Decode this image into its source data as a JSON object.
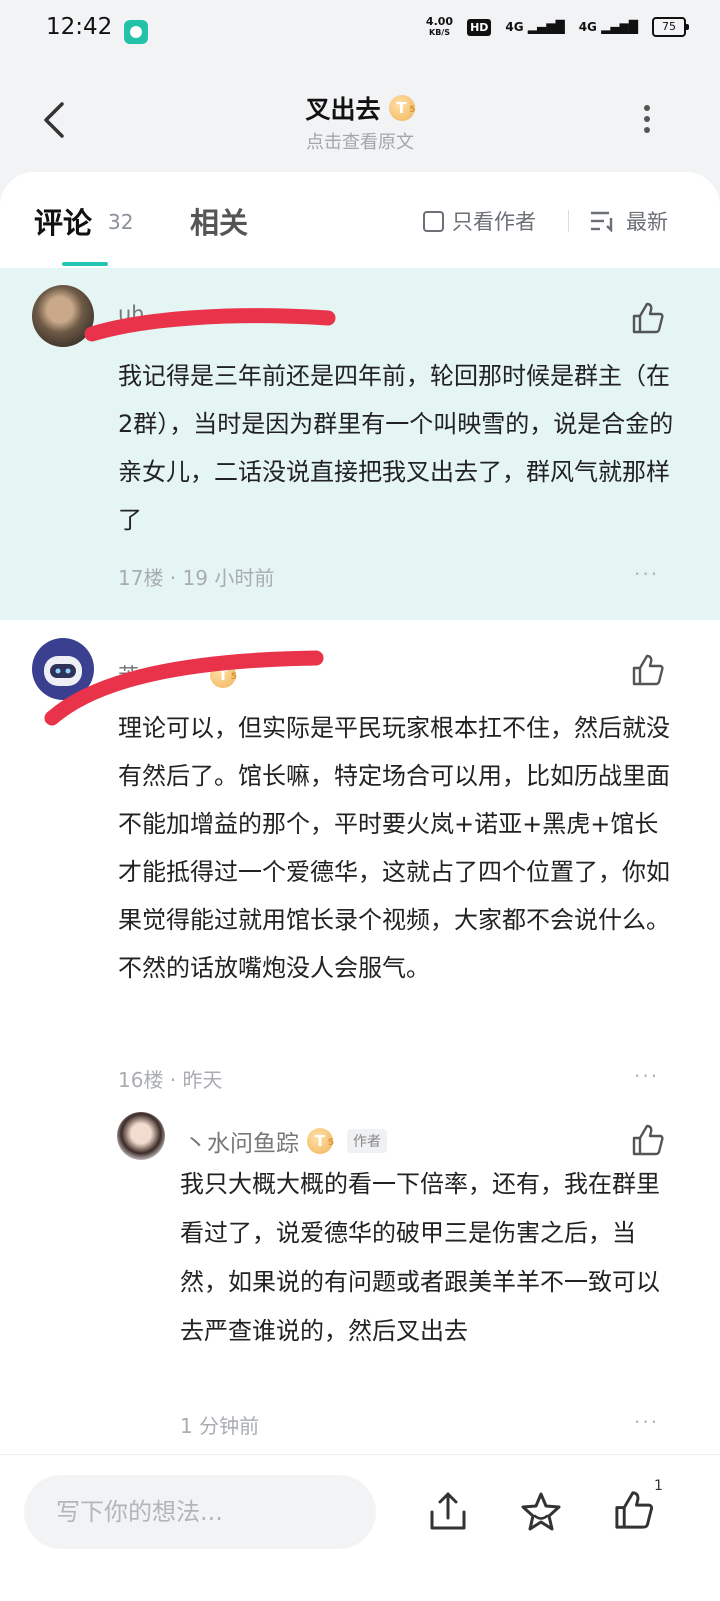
{
  "status_bar": {
    "time": "12:42",
    "net_speed_value": "4.00",
    "net_speed_unit": "KB/S",
    "hd": "HD",
    "signal1": "4G",
    "signal2": "4G",
    "battery": "75"
  },
  "header": {
    "title": "叉出去",
    "title_badge": "T",
    "title_badge_level": "5",
    "subtitle": "点击查看原文"
  },
  "tabs": {
    "comments_label": "评论",
    "comments_count": "32",
    "related_label": "相关",
    "author_only_label": "只看作者",
    "sort_label": "最新"
  },
  "comments": [
    {
      "text": "我记得是三年前还是四年前，轮回那时候是群主（在2群），当时是因为群里有一个叫映雪的，说是合金的亲女儿，二话没说直接把我叉出去了，群风气就那样了",
      "floor": "17楼 · 19 小时前",
      "more": "···"
    },
    {
      "text": "理论可以，但实际是平民玩家根本扛不住，然后就没有然后了。馆长嘛，特定场合可以用，比如历战里面不能加增益的那个，平时要火岚+诺亚+黑虎+馆长才能抵得过一个爱德华，这就占了四个位置了，你如果觉得能过就用馆长录个视频，大家都不会说什么。不然的话放嘴炮没人会服气。",
      "floor": "16楼 · 昨天",
      "more": "···",
      "reply": {
        "username": "丶水问鱼踪",
        "badge": "T",
        "badge_level": "5",
        "author_tag": "作者",
        "text": "我只大概大概的看一下倍率，还有，我在群里看过了，说爱德华的破甲三是伤害之后，当然，如果说的有问题或者跟美羊羊不一致可以去严查谁说的，然后叉出去",
        "time": "1 分钟前",
        "more": "···"
      }
    }
  ],
  "bottom_bar": {
    "input_placeholder": "写下你的想法...",
    "like_count": "1"
  },
  "colors": {
    "accent": "#24c6b3",
    "highlight_bg": "#e4f5f3",
    "redaction": "#e8334a"
  }
}
